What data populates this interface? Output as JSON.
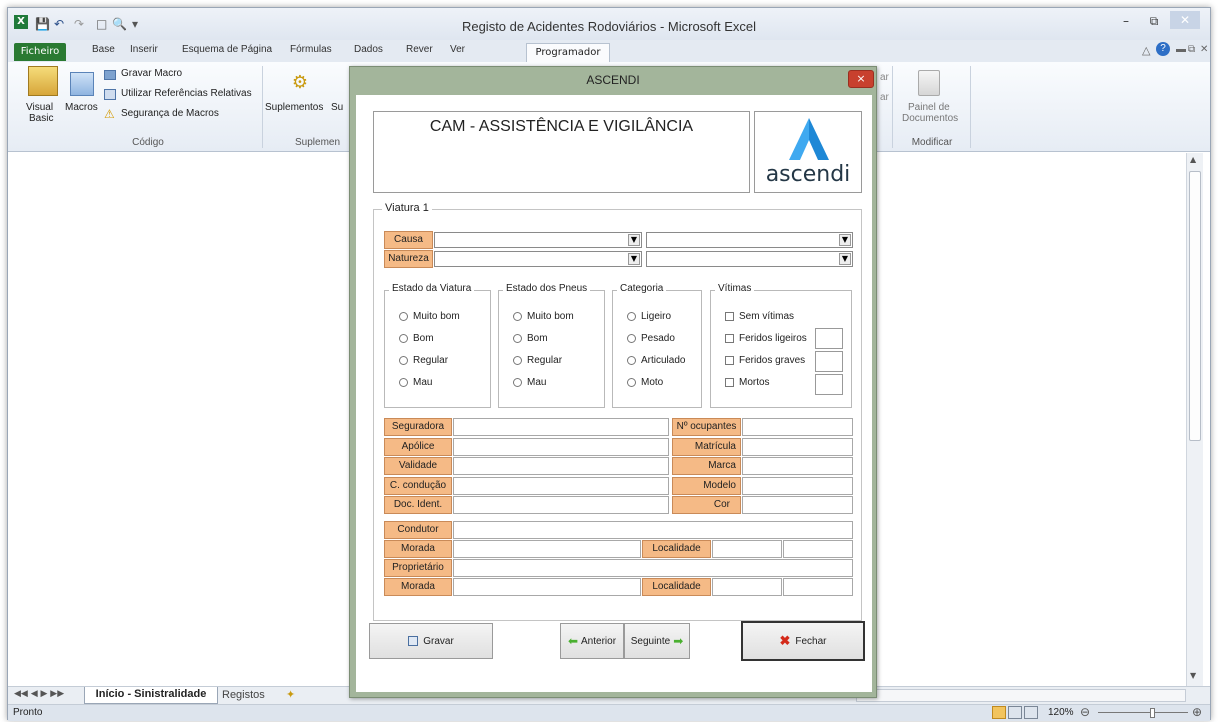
{
  "window": {
    "title": "Registo de Acidentes Rodoviários - Microsoft Excel",
    "minimize_icon": "minimize-icon",
    "restore_icon": "restore-icon",
    "close_icon": "close-icon"
  },
  "ribbon_tabs": [
    "Ficheiro",
    "Base",
    "Inserir",
    "Esquema de Página",
    "Fórmulas",
    "Dados",
    "Rever",
    "Ver",
    "Programador"
  ],
  "ribbon": {
    "visual_basic_1": "Visual",
    "visual_basic_2": "Basic",
    "macros": "Macros",
    "record_macro": "Gravar Macro",
    "relative_refs": "Utilizar Referências Relativas",
    "macro_security": "Segurança de Macros",
    "group_code": "Código",
    "addins": "Suplementos",
    "addins_cut": "Su",
    "group_addins": "Suplemen",
    "doc_panel_1": "Painel de",
    "doc_panel_2": "Documentos",
    "group_modify": "Modificar",
    "hidden_ar_1": "ar",
    "hidden_ar_2": "ar"
  },
  "dialog": {
    "title": "ASCENDI",
    "close_symbol": "×",
    "header_text": "CAM - ASSISTÊNCIA E VIGILÂNCIA",
    "logo_text": "ascendi",
    "group_vehicle": "Viatura 1",
    "cause_label": "Causa",
    "nature_label": "Natureza",
    "estado_viatura": {
      "title": "Estado da Viatura",
      "options": [
        "Muito bom",
        "Bom",
        "Regular",
        "Mau"
      ]
    },
    "estado_pneus": {
      "title": "Estado dos Pneus",
      "options": [
        "Muito bom",
        "Bom",
        "Regular",
        "Mau"
      ]
    },
    "categoria": {
      "title": "Categoria",
      "options": [
        "Ligeiro",
        "Pesado",
        "Articulado",
        "Moto"
      ]
    },
    "vitimas": {
      "title": "Vítimas",
      "options": [
        "Sem vítimas",
        "Feridos ligeiros",
        "Feridos graves",
        "Mortos"
      ]
    },
    "left_fields": [
      "Seguradora",
      "Apólice",
      "Validade",
      "C. condução",
      "Doc. Ident."
    ],
    "right_fields": [
      "Nº ocupantes",
      "Matrícula",
      "Marca",
      "Modelo",
      "Cor"
    ],
    "condutor": "Condutor",
    "morada": "Morada",
    "localidade": "Localidade",
    "proprietario": "Proprietário",
    "btn_save": "Gravar",
    "btn_prev": "Anterior",
    "btn_next": "Seguinte",
    "btn_close": "Fechar"
  },
  "sheet_tabs": [
    "Início - Sinistralidade",
    "Registos"
  ],
  "status": {
    "ready": "Pronto",
    "zoom": "120%"
  }
}
